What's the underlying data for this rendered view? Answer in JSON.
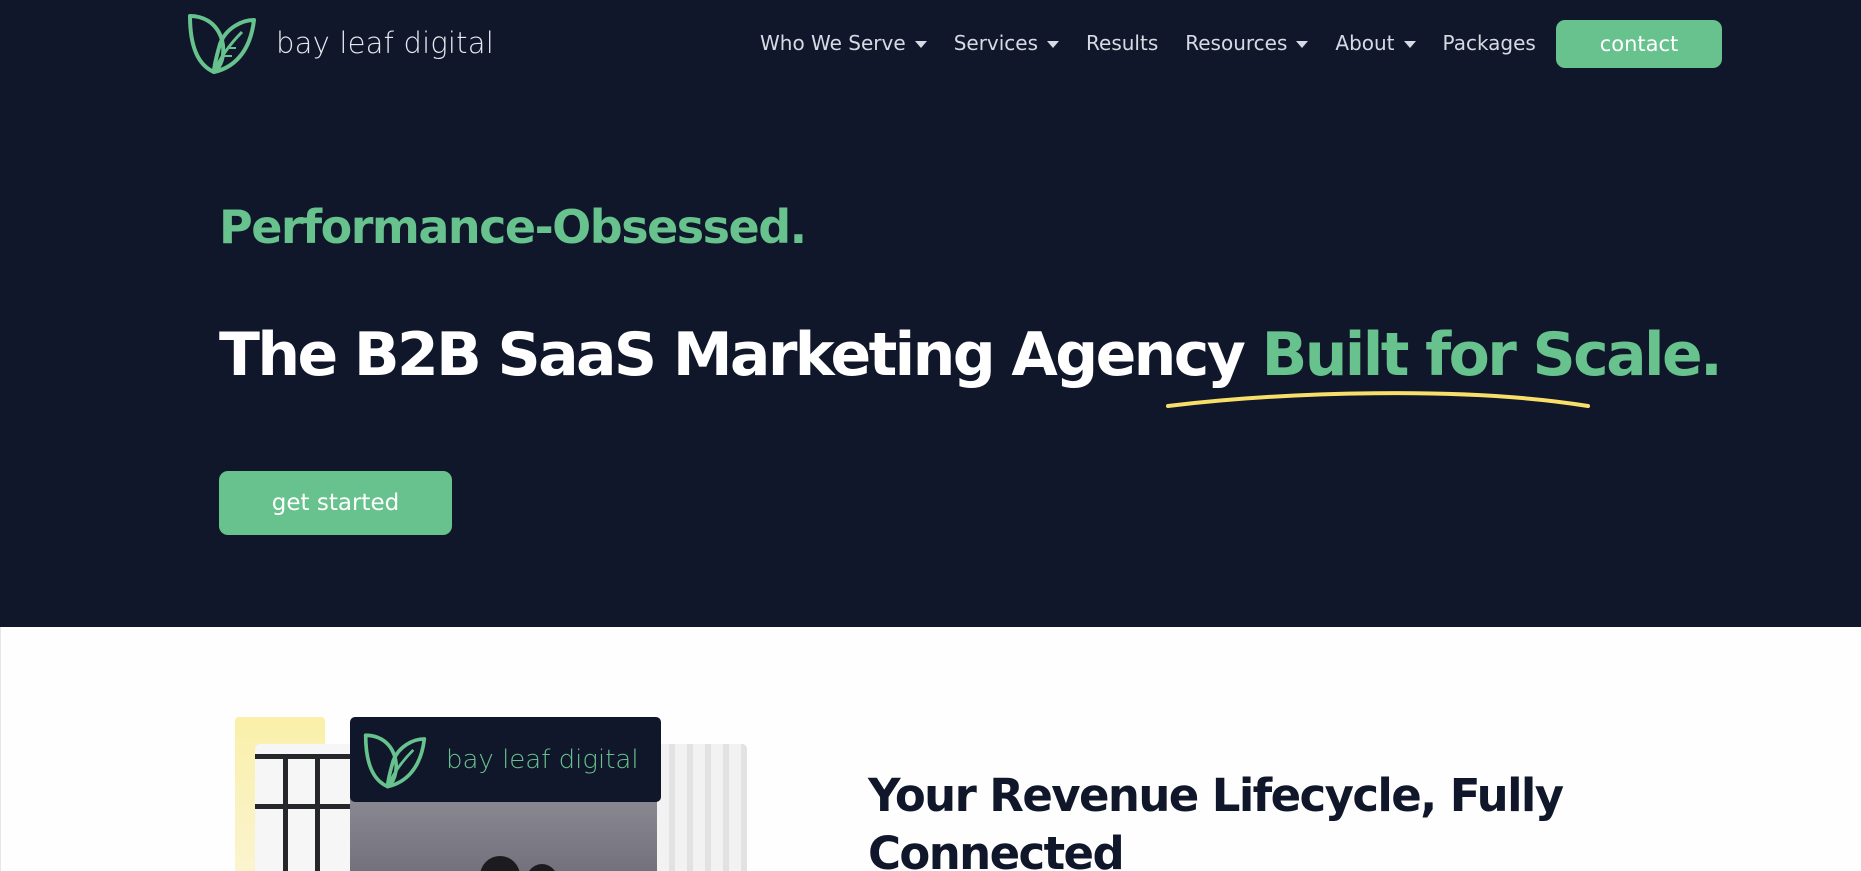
{
  "brand": {
    "name": "bay leaf digital",
    "colors": {
      "navy": "#10172a",
      "green": "#67c28d",
      "yellow": "#f8df6a"
    }
  },
  "header": {
    "logo_icon": "leaf-logo-icon",
    "nav": [
      {
        "label": "Who We Serve",
        "has_dropdown": true
      },
      {
        "label": "Services",
        "has_dropdown": true
      },
      {
        "label": "Results",
        "has_dropdown": false
      },
      {
        "label": "Resources",
        "has_dropdown": true
      },
      {
        "label": "About",
        "has_dropdown": true
      },
      {
        "label": "Packages",
        "has_dropdown": false
      }
    ],
    "contact_label": "contact"
  },
  "hero": {
    "eyebrow": "Performance-Obsessed.",
    "headline_main": "The B2B SaaS Marketing Agency ",
    "headline_accent": "Built for Scale.",
    "cta_label": "get started"
  },
  "section": {
    "badge_text": "bay leaf digital",
    "title": "Your Revenue Lifecycle, Fully Connected"
  }
}
